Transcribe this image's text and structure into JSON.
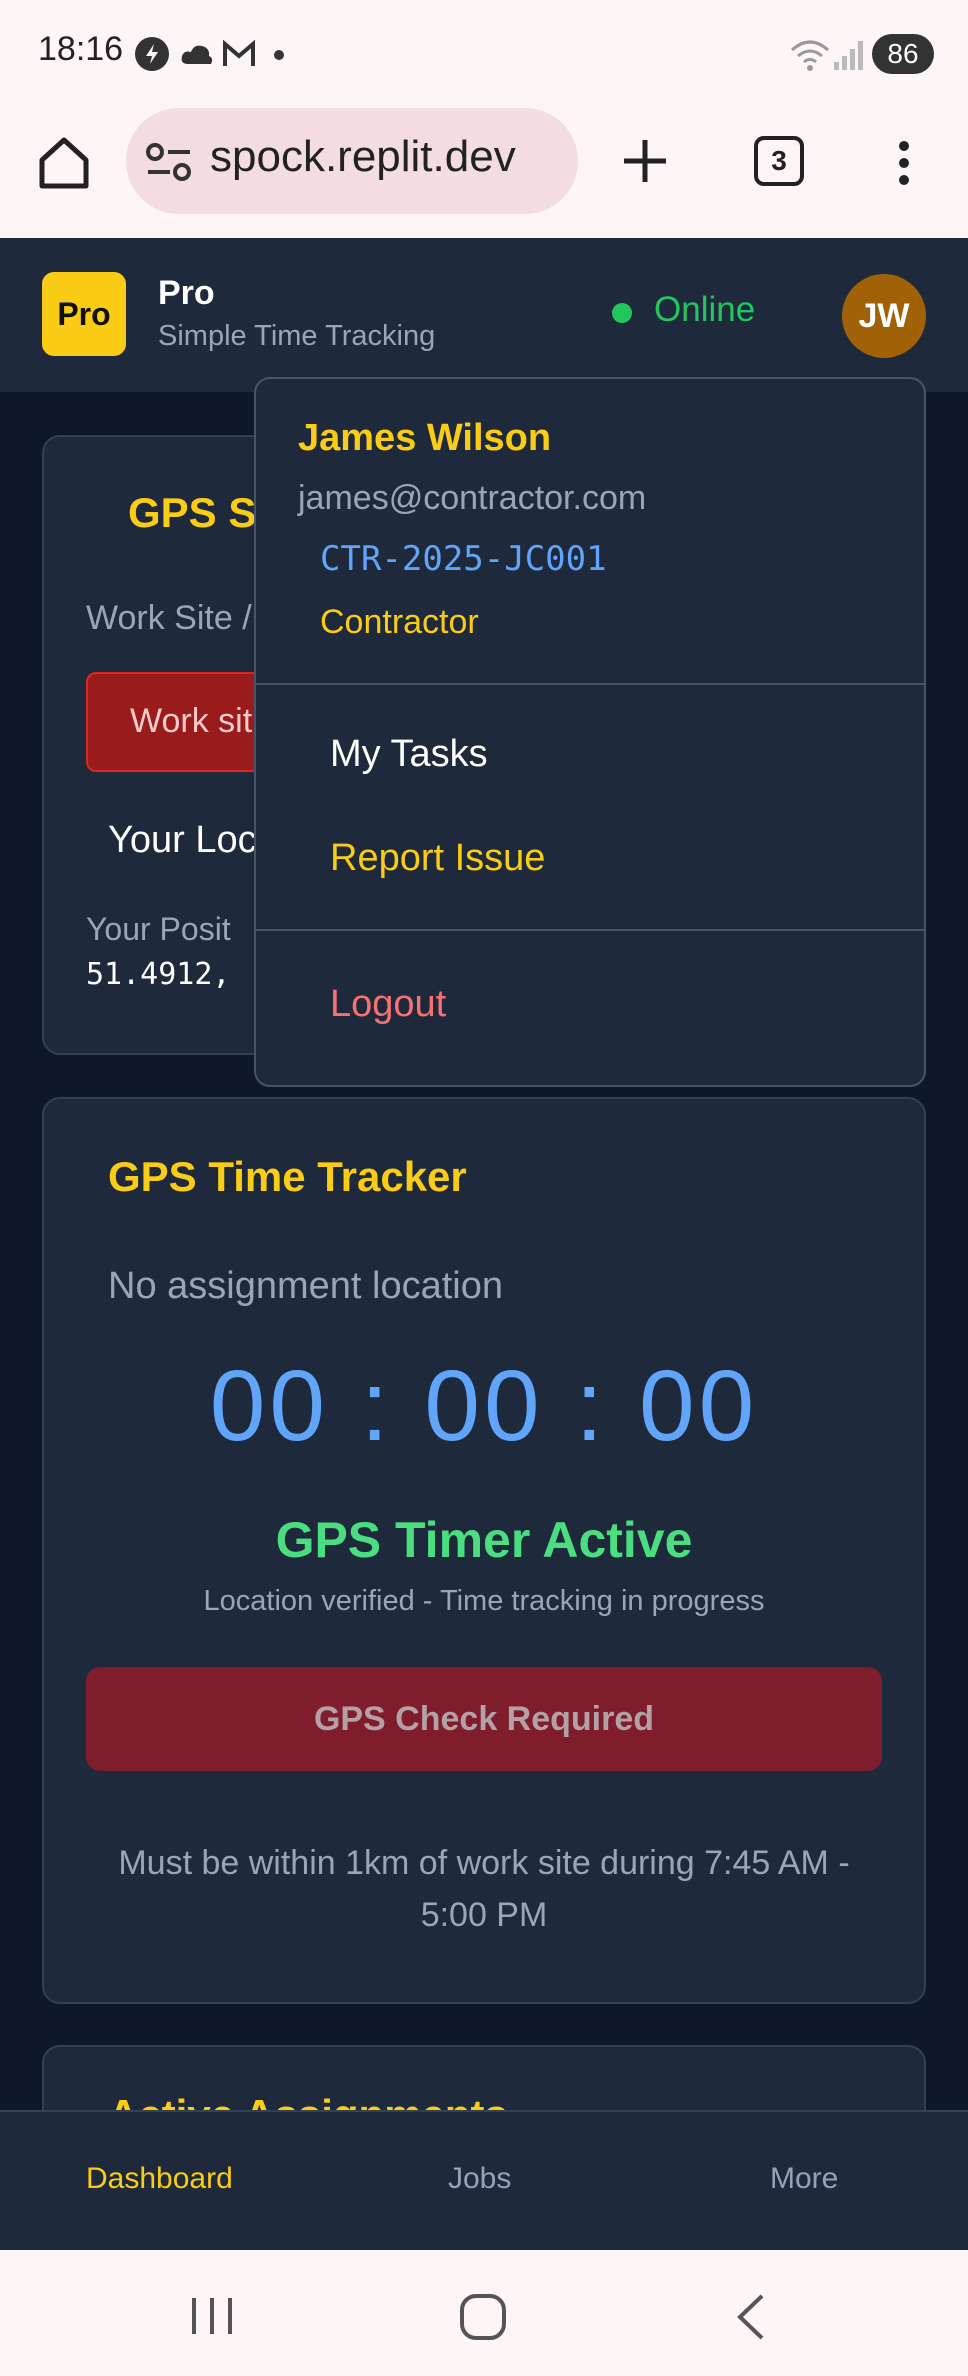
{
  "status_bar": {
    "time": "18:16",
    "battery": "86",
    "icons": [
      "sync-icon",
      "cloud-icon",
      "gmail-icon",
      "dot-icon",
      "wifi-icon",
      "signal-icon"
    ]
  },
  "browser": {
    "url": "spock.replit.dev",
    "tab_count": "3"
  },
  "app": {
    "logo": "Pro",
    "title": "Pro",
    "subtitle": "Simple Time Tracking",
    "status": "Online",
    "avatar_initials": "JW"
  },
  "gps_card": {
    "title_partial": "GPS S",
    "worksite_label_partial": "Work Site /",
    "worksite_button_partial": "Work sit",
    "your_location_partial": "Your Loc",
    "position_label_partial": "Your Posit",
    "position_value_partial": "51.4912,"
  },
  "user_menu": {
    "name": "James Wilson",
    "email": "james@contractor.com",
    "contractor_id": "CTR-2025-JC001",
    "role": "Contractor",
    "items": [
      {
        "label": "My Tasks"
      },
      {
        "label": "Report Issue"
      }
    ],
    "logout": "Logout"
  },
  "tracker": {
    "title": "GPS Time Tracker",
    "location_text": "No assignment location",
    "timer": {
      "hours": "00",
      "minutes": "00",
      "seconds": "00"
    },
    "status_title": "GPS Timer Active",
    "status_sub": "Location verified - Time tracking in progress",
    "button_label": "GPS Check Required",
    "note": "Must be within 1km of work site during 7:45 AM - 5:00 PM"
  },
  "next_card": {
    "title_partial": "Active Assignments"
  },
  "bottom_nav": {
    "items": [
      {
        "label": "Dashboard"
      },
      {
        "label": "Jobs"
      },
      {
        "label": "More"
      }
    ]
  },
  "colors": {
    "accent_yellow": "#facc15",
    "online_green": "#22c55e",
    "timer_blue": "#60a5fa",
    "logout_red": "#f87171",
    "active_green": "#4ade80"
  }
}
